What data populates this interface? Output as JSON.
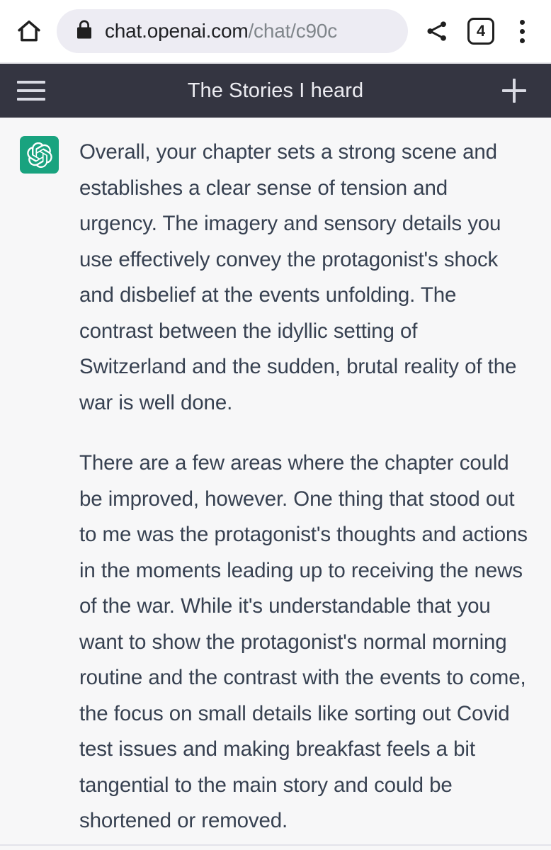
{
  "browser": {
    "home_icon": "home-icon",
    "lock_icon": "lock-icon",
    "url_host": "chat.openai.com",
    "url_path": "/chat/c90c",
    "url_full": "chat.openai.com/chat/c90c",
    "share_icon": "share-icon",
    "tab_count": "4",
    "menu_icon": "overflow-menu-icon"
  },
  "app_header": {
    "menu_icon": "hamburger-menu-icon",
    "title": "The Stories I heard",
    "new_chat_icon": "plus-icon",
    "background_color": "#343541",
    "title_color": "#ececf1"
  },
  "conversation": {
    "background_color": "#f7f7f8",
    "message": {
      "author": "assistant",
      "avatar_icon": "openai-logo-icon",
      "avatar_color": "#19a37f",
      "text_color": "#374151",
      "paragraphs": [
        "Overall, your chapter sets a strong scene and establishes a clear sense of tension and urgency. The imagery and sensory details you use effectively convey the protagonist's shock and disbelief at the events unfolding. The contrast between the idyllic setting of Switzerland and the sudden, brutal reality of the war is well done.",
        "There are a few areas where the chapter could be improved, however. One thing that stood out to me was the protagonist's thoughts and actions in the moments leading up to receiving the news of the war. While it's understandable that you want to show the protagonist's normal morning routine and the contrast with the events to come, the focus on small details like sorting out Covid test issues and making breakfast feels a bit tangential to the main story and could be shortened or removed."
      ]
    }
  }
}
